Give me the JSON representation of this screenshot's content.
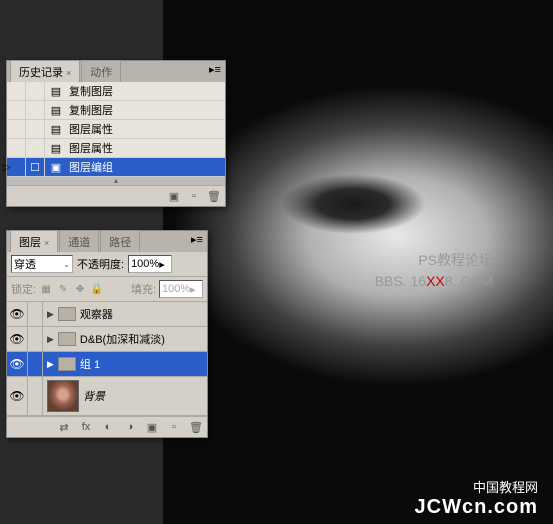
{
  "watermark": {
    "line1": "PS教程论坛",
    "line2_a": "BBS. 16",
    "line2_b": "XX",
    "line2_c": "8. COM"
  },
  "footer_wm": {
    "line1": "中国教程网",
    "line2": "JCWcn.com"
  },
  "history_panel": {
    "tabs": [
      {
        "label": "历史记录",
        "active": true
      },
      {
        "label": "动作",
        "active": false
      }
    ],
    "items": [
      {
        "label": "复制图层",
        "selected": false,
        "pointer": false
      },
      {
        "label": "复制图层",
        "selected": false,
        "pointer": false
      },
      {
        "label": "图层属性",
        "selected": false,
        "pointer": false
      },
      {
        "label": "图层属性",
        "selected": false,
        "pointer": false
      },
      {
        "label": "图层编组",
        "selected": true,
        "pointer": true
      }
    ]
  },
  "layers_panel": {
    "tabs": [
      {
        "label": "图层",
        "active": true
      },
      {
        "label": "通道",
        "active": false
      },
      {
        "label": "路径",
        "active": false
      }
    ],
    "blend_mode": "穿透",
    "opacity_label": "不透明度:",
    "opacity_value": "100%",
    "lock_label": "锁定:",
    "fill_label": "填充:",
    "fill_value": "100%",
    "layers": [
      {
        "name": "观察器",
        "type": "group",
        "selected": false
      },
      {
        "name": "D&B(加深和减淡)",
        "type": "group",
        "selected": false
      },
      {
        "name": "组 1",
        "type": "group",
        "selected": true
      },
      {
        "name": "背景",
        "type": "layer",
        "selected": false
      }
    ]
  }
}
